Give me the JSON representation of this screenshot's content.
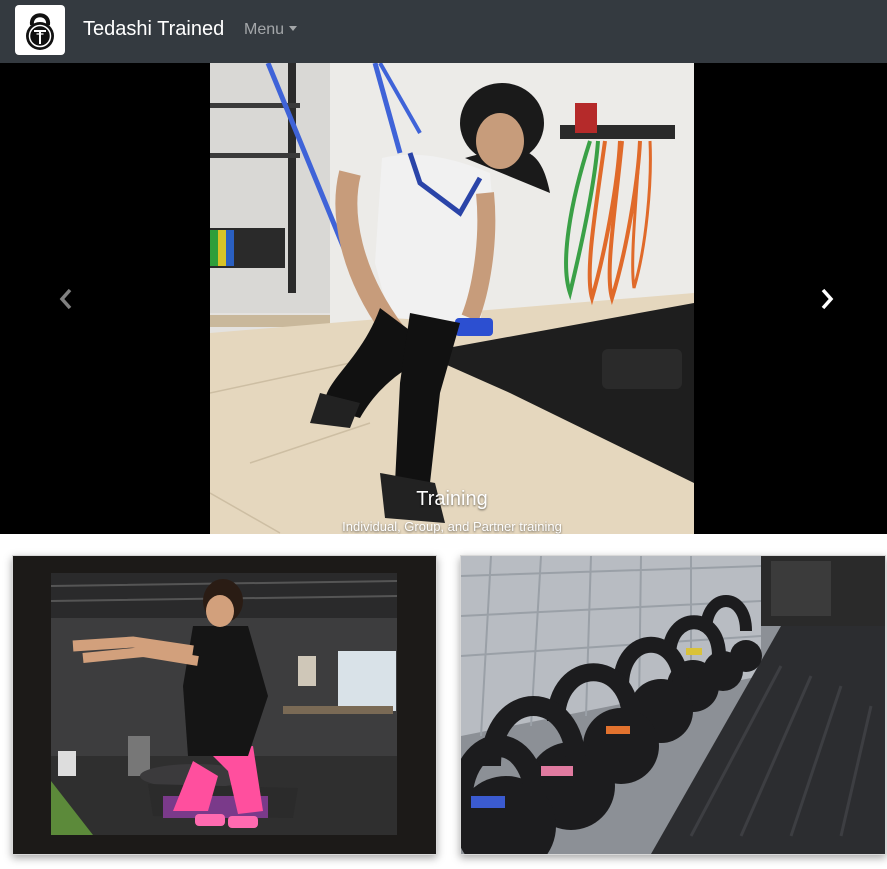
{
  "brand": {
    "name": "Tedashi Trained",
    "logo_icon": "kettlebell-logo-icon"
  },
  "nav": {
    "menu_label": "Menu"
  },
  "carousel": {
    "prev_icon": "chevron-left-icon",
    "next_icon": "chevron-right-icon",
    "slides": [
      {
        "title": "Training",
        "text": "Individual, Group, and Partner training"
      }
    ]
  },
  "cards": [
    {
      "photo": "box-squat-photo"
    },
    {
      "photo": "kettlebell-row-photo"
    }
  ],
  "colors": {
    "navbar_bg": "#343a40",
    "carousel_bg": "#000000",
    "page_bg": "#ffffff"
  }
}
